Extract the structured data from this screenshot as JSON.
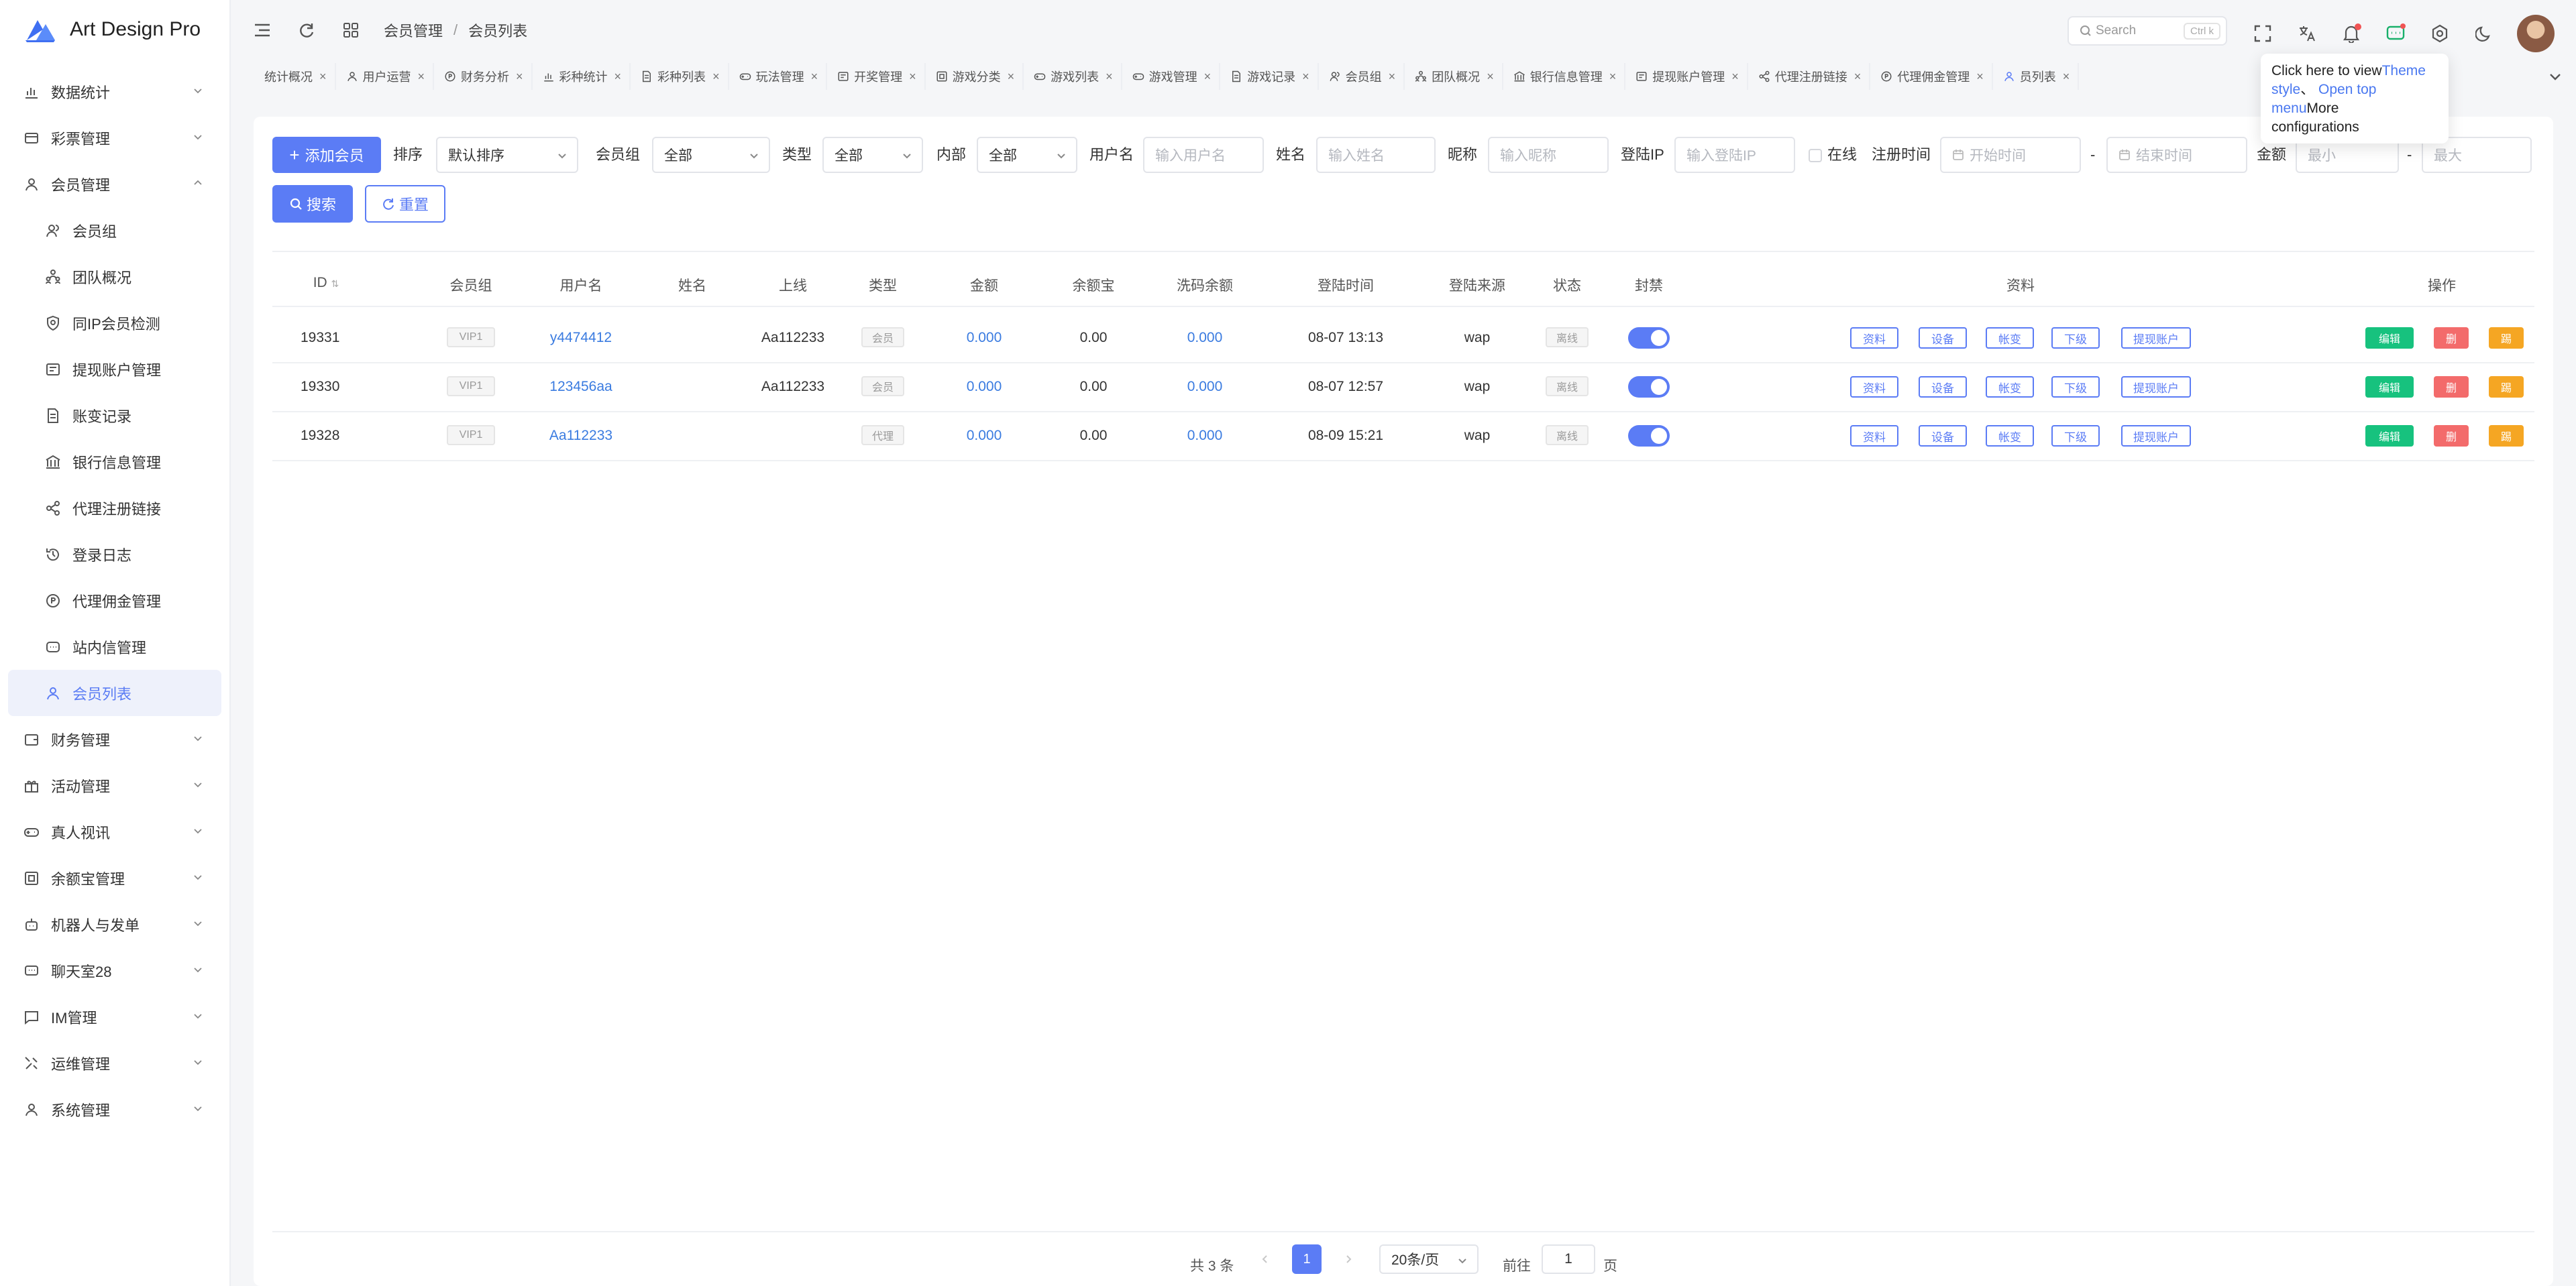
{
  "app": {
    "title": "Art Design Pro"
  },
  "sidebar": {
    "groups": [
      {
        "label": "数据统计",
        "icon": "chart-icon"
      },
      {
        "label": "彩票管理",
        "icon": "lottery-icon"
      },
      {
        "label": "会员管理",
        "icon": "user-icon",
        "expanded": true
      }
    ],
    "member_items": [
      {
        "label": "会员组",
        "icon": "users-icon"
      },
      {
        "label": "团队概况",
        "icon": "team-icon"
      },
      {
        "label": "同IP会员检测",
        "icon": "shield-icon"
      },
      {
        "label": "提现账户管理",
        "icon": "card-icon"
      },
      {
        "label": "账变记录",
        "icon": "record-icon"
      },
      {
        "label": "银行信息管理",
        "icon": "bank-icon"
      },
      {
        "label": "代理注册链接",
        "icon": "share-icon"
      },
      {
        "label": "登录日志",
        "icon": "history-icon"
      },
      {
        "label": "代理佣金管理",
        "icon": "coin-icon"
      },
      {
        "label": "站内信管理",
        "icon": "message-icon"
      },
      {
        "label": "会员列表",
        "icon": "user-list-icon",
        "active": true
      }
    ],
    "groups_after": [
      {
        "label": "财务管理",
        "icon": "wallet-icon"
      },
      {
        "label": "活动管理",
        "icon": "gift-icon"
      },
      {
        "label": "真人视讯",
        "icon": "gamepad-icon"
      },
      {
        "label": "余额宝管理",
        "icon": "vault-icon"
      },
      {
        "label": "机器人与发单",
        "icon": "robot-icon"
      },
      {
        "label": "聊天室28",
        "icon": "chat-icon"
      },
      {
        "label": "IM管理",
        "icon": "im-icon"
      },
      {
        "label": "运维管理",
        "icon": "tools-icon"
      },
      {
        "label": "系统管理",
        "icon": "settings-user-icon"
      }
    ]
  },
  "header": {
    "breadcrumb": [
      "会员管理",
      "会员列表"
    ],
    "breadcrumb_sep": "/",
    "search_placeholder": "Search",
    "search_shortcut": "Ctrl k"
  },
  "tabs": [
    {
      "label": "统计概况"
    },
    {
      "label": "用户运营"
    },
    {
      "label": "财务分析"
    },
    {
      "label": "彩种统计"
    },
    {
      "label": "彩种列表"
    },
    {
      "label": "玩法管理"
    },
    {
      "label": "开奖管理"
    },
    {
      "label": "游戏分类"
    },
    {
      "label": "游戏列表"
    },
    {
      "label": "游戏管理"
    },
    {
      "label": "游戏记录"
    },
    {
      "label": "会员组"
    },
    {
      "label": "团队概况"
    },
    {
      "label": "银行信息管理"
    },
    {
      "label": "提现账户管理"
    },
    {
      "label": "代理注册链接"
    },
    {
      "label": "代理佣金管理"
    },
    {
      "label": "员列表"
    }
  ],
  "tooltip": {
    "line1a": "Click here to view",
    "line1b": "Theme",
    "line2a": "style",
    "line2b": "、",
    "line2c": "Open top",
    "line3a": "menu",
    "line3b": "More",
    "line4": "configurations"
  },
  "filters": {
    "add_button": "添加会员",
    "sort_label": "排序",
    "sort_value": "默认排序",
    "group_label": "会员组",
    "group_value": "全部",
    "type_label": "类型",
    "type_value": "全部",
    "internal_label": "内部",
    "internal_value": "全部",
    "username_label": "用户名",
    "username_placeholder": "输入用户名",
    "name_label": "姓名",
    "name_placeholder": "输入姓名",
    "nickname_label": "昵称",
    "nickname_placeholder": "输入昵称",
    "ip_label": "登陆IP",
    "ip_placeholder": "输入登陆IP",
    "online_label": "在线",
    "regtime_label": "注册时间",
    "start_placeholder": "开始时间",
    "end_placeholder": "结束时间",
    "range_sep": "-",
    "amount_label": "金额",
    "min_placeholder": "最小",
    "max_placeholder": "最大",
    "search_button": "搜索",
    "reset_button": "重置"
  },
  "table": {
    "headers": [
      "ID",
      "会员组",
      "用户名",
      "姓名",
      "上线",
      "类型",
      "金额",
      "余额宝",
      "洗码余额",
      "登陆时间",
      "登陆来源",
      "状态",
      "封禁",
      "资料",
      "操作"
    ],
    "rows": [
      {
        "id": "19331",
        "group": "VIP1",
        "username": "y4474412",
        "name": "",
        "upline": "Aa112233",
        "type": "会员",
        "amount": "0.000",
        "yuebao": "0.00",
        "wash": "0.000",
        "login_time": "08-07 13:13",
        "source": "wap",
        "status": "离线",
        "banned": true
      },
      {
        "id": "19330",
        "group": "VIP1",
        "username": "123456aa",
        "name": "",
        "upline": "Aa112233",
        "type": "会员",
        "amount": "0.000",
        "yuebao": "0.00",
        "wash": "0.000",
        "login_time": "08-07 12:57",
        "source": "wap",
        "status": "离线",
        "banned": true
      },
      {
        "id": "19328",
        "group": "VIP1",
        "username": "Aa112233",
        "name": "",
        "upline": "",
        "type": "代理",
        "amount": "0.000",
        "yuebao": "0.00",
        "wash": "0.000",
        "login_time": "08-09 15:21",
        "source": "wap",
        "status": "离线",
        "banned": true
      }
    ],
    "info_buttons": [
      "资料",
      "设备",
      "帐变",
      "下级",
      "提现账户"
    ],
    "op_buttons": [
      "编辑",
      "删",
      "踢"
    ]
  },
  "pagination": {
    "total": "共 3 条",
    "current": "1",
    "page_size": "20条/页",
    "goto_label": "前往",
    "goto_value": "1",
    "page_suffix": "页"
  },
  "colors": {
    "accent": "#5b7cf5",
    "link": "#3a7be0",
    "edit": "#17c27e",
    "delete": "#f36b6b",
    "kick": "#f5a623"
  }
}
